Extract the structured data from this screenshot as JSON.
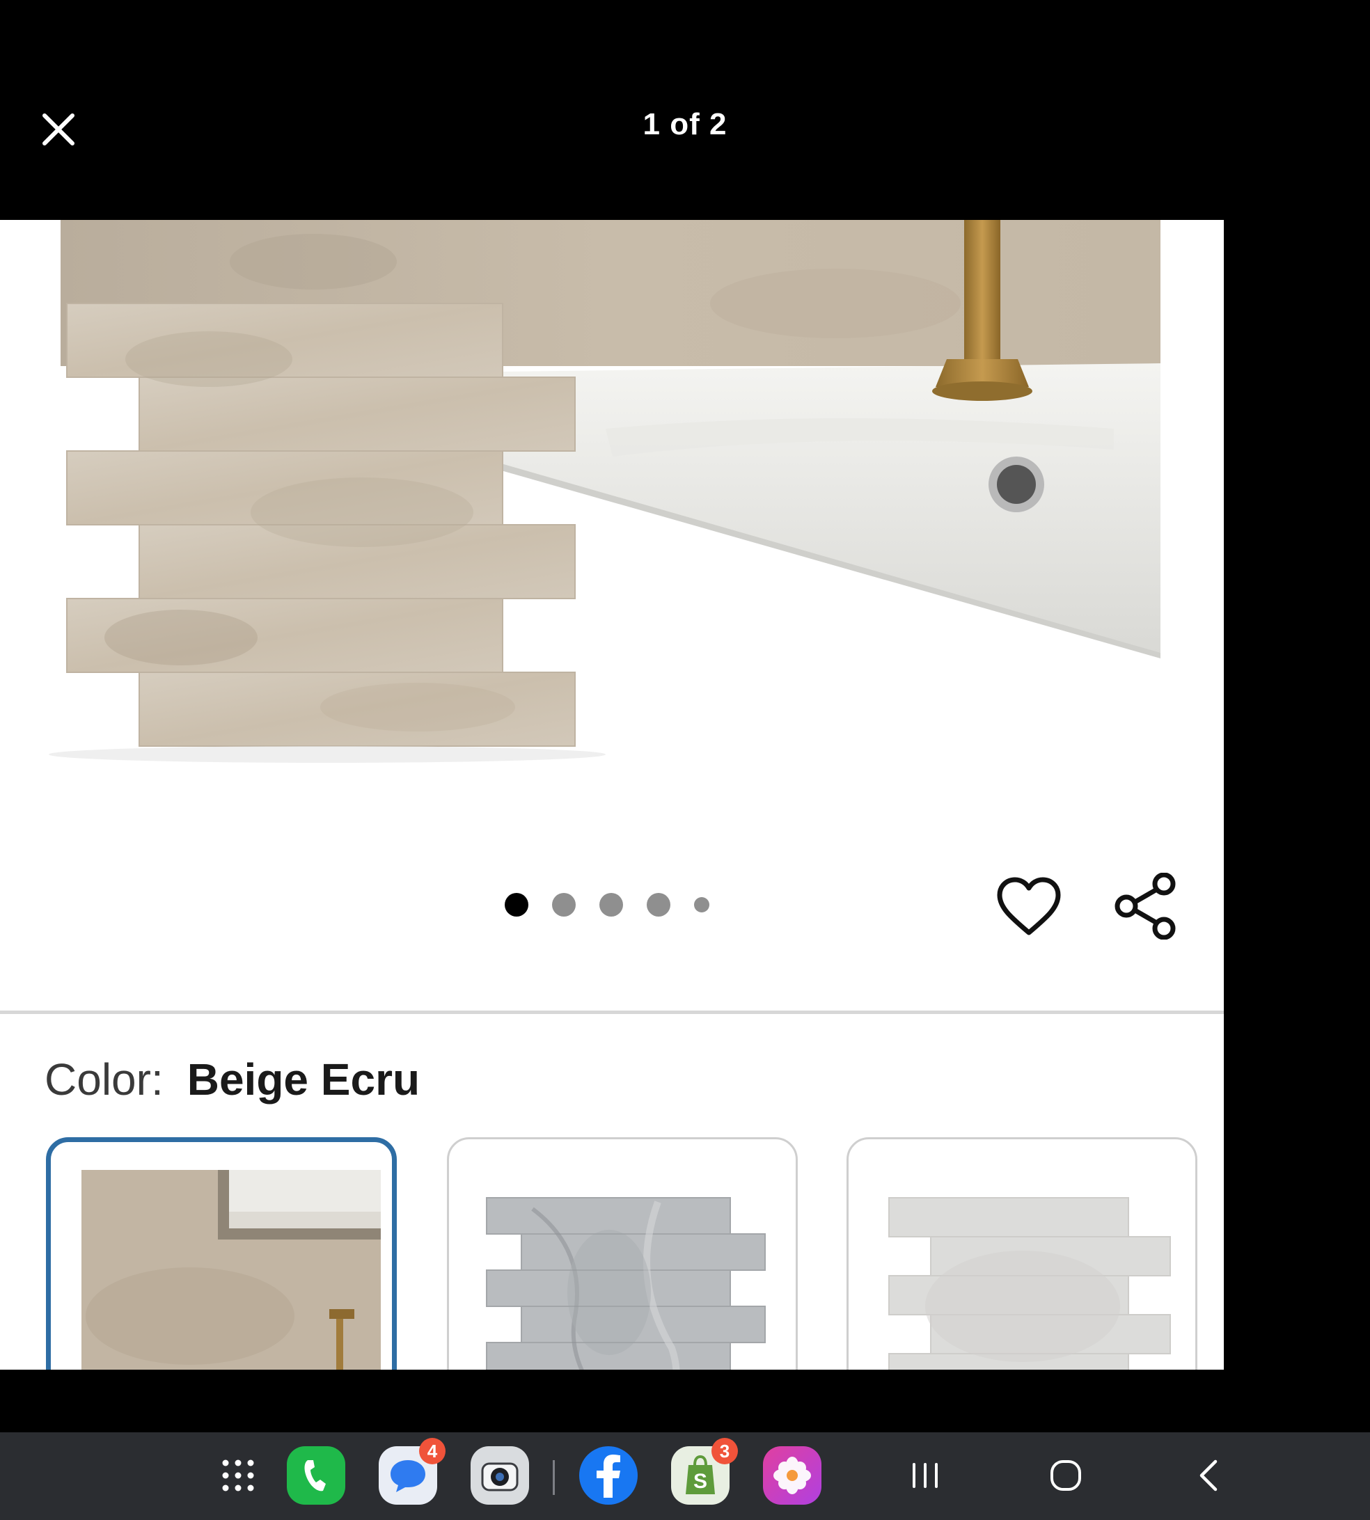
{
  "viewer": {
    "counter": "1 of 2",
    "close_icon": "close-icon"
  },
  "gallery": {
    "image_count": 5,
    "active_index": 0,
    "wishlist_icon": "heart-outline-icon",
    "share_icon": "share-icon"
  },
  "product": {
    "color_label": "Color:",
    "color_value": "Beige Ecru",
    "swatches": [
      {
        "name": "beige-ecru",
        "selected": true
      },
      {
        "name": "grey-marble",
        "selected": false
      },
      {
        "name": "light-grey",
        "selected": false
      }
    ]
  },
  "nav_bar": {
    "apps": [
      {
        "name": "app-drawer",
        "icon": "grid-icon"
      },
      {
        "name": "phone",
        "icon": "phone-icon",
        "color": "#1fb94a"
      },
      {
        "name": "messages",
        "icon": "chat-bubble-icon",
        "color": "#2f7bf0",
        "badge": "4"
      },
      {
        "name": "camera",
        "icon": "camera-icon"
      },
      {
        "name": "facebook",
        "icon": "facebook-icon",
        "color": "#1877f2"
      },
      {
        "name": "shopify",
        "icon": "shopify-bag-icon",
        "color": "#5e9b3b",
        "badge": "3"
      },
      {
        "name": "gallery",
        "icon": "flower-icon"
      }
    ],
    "system_buttons": [
      "recent-apps-icon",
      "home-icon",
      "back-icon"
    ]
  }
}
